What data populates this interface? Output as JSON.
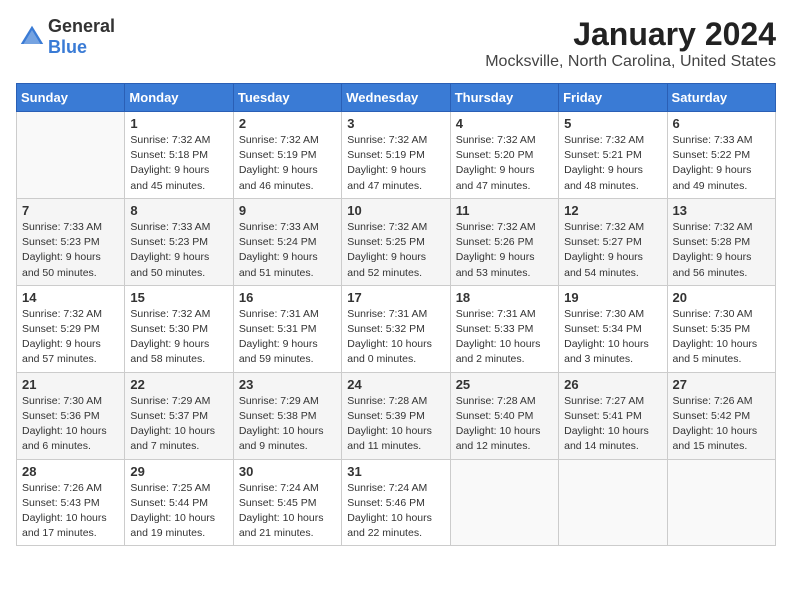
{
  "header": {
    "logo_general": "General",
    "logo_blue": "Blue",
    "month": "January 2024",
    "location": "Mocksville, North Carolina, United States"
  },
  "days_of_week": [
    "Sunday",
    "Monday",
    "Tuesday",
    "Wednesday",
    "Thursday",
    "Friday",
    "Saturday"
  ],
  "weeks": [
    [
      {
        "day": "",
        "content": ""
      },
      {
        "day": "1",
        "content": "Sunrise: 7:32 AM\nSunset: 5:18 PM\nDaylight: 9 hours\nand 45 minutes."
      },
      {
        "day": "2",
        "content": "Sunrise: 7:32 AM\nSunset: 5:19 PM\nDaylight: 9 hours\nand 46 minutes."
      },
      {
        "day": "3",
        "content": "Sunrise: 7:32 AM\nSunset: 5:19 PM\nDaylight: 9 hours\nand 47 minutes."
      },
      {
        "day": "4",
        "content": "Sunrise: 7:32 AM\nSunset: 5:20 PM\nDaylight: 9 hours\nand 47 minutes."
      },
      {
        "day": "5",
        "content": "Sunrise: 7:32 AM\nSunset: 5:21 PM\nDaylight: 9 hours\nand 48 minutes."
      },
      {
        "day": "6",
        "content": "Sunrise: 7:33 AM\nSunset: 5:22 PM\nDaylight: 9 hours\nand 49 minutes."
      }
    ],
    [
      {
        "day": "7",
        "content": "Sunrise: 7:33 AM\nSunset: 5:23 PM\nDaylight: 9 hours\nand 50 minutes."
      },
      {
        "day": "8",
        "content": "Sunrise: 7:33 AM\nSunset: 5:23 PM\nDaylight: 9 hours\nand 50 minutes."
      },
      {
        "day": "9",
        "content": "Sunrise: 7:33 AM\nSunset: 5:24 PM\nDaylight: 9 hours\nand 51 minutes."
      },
      {
        "day": "10",
        "content": "Sunrise: 7:32 AM\nSunset: 5:25 PM\nDaylight: 9 hours\nand 52 minutes."
      },
      {
        "day": "11",
        "content": "Sunrise: 7:32 AM\nSunset: 5:26 PM\nDaylight: 9 hours\nand 53 minutes."
      },
      {
        "day": "12",
        "content": "Sunrise: 7:32 AM\nSunset: 5:27 PM\nDaylight: 9 hours\nand 54 minutes."
      },
      {
        "day": "13",
        "content": "Sunrise: 7:32 AM\nSunset: 5:28 PM\nDaylight: 9 hours\nand 56 minutes."
      }
    ],
    [
      {
        "day": "14",
        "content": "Sunrise: 7:32 AM\nSunset: 5:29 PM\nDaylight: 9 hours\nand 57 minutes."
      },
      {
        "day": "15",
        "content": "Sunrise: 7:32 AM\nSunset: 5:30 PM\nDaylight: 9 hours\nand 58 minutes."
      },
      {
        "day": "16",
        "content": "Sunrise: 7:31 AM\nSunset: 5:31 PM\nDaylight: 9 hours\nand 59 minutes."
      },
      {
        "day": "17",
        "content": "Sunrise: 7:31 AM\nSunset: 5:32 PM\nDaylight: 10 hours\nand 0 minutes."
      },
      {
        "day": "18",
        "content": "Sunrise: 7:31 AM\nSunset: 5:33 PM\nDaylight: 10 hours\nand 2 minutes."
      },
      {
        "day": "19",
        "content": "Sunrise: 7:30 AM\nSunset: 5:34 PM\nDaylight: 10 hours\nand 3 minutes."
      },
      {
        "day": "20",
        "content": "Sunrise: 7:30 AM\nSunset: 5:35 PM\nDaylight: 10 hours\nand 5 minutes."
      }
    ],
    [
      {
        "day": "21",
        "content": "Sunrise: 7:30 AM\nSunset: 5:36 PM\nDaylight: 10 hours\nand 6 minutes."
      },
      {
        "day": "22",
        "content": "Sunrise: 7:29 AM\nSunset: 5:37 PM\nDaylight: 10 hours\nand 7 minutes."
      },
      {
        "day": "23",
        "content": "Sunrise: 7:29 AM\nSunset: 5:38 PM\nDaylight: 10 hours\nand 9 minutes."
      },
      {
        "day": "24",
        "content": "Sunrise: 7:28 AM\nSunset: 5:39 PM\nDaylight: 10 hours\nand 11 minutes."
      },
      {
        "day": "25",
        "content": "Sunrise: 7:28 AM\nSunset: 5:40 PM\nDaylight: 10 hours\nand 12 minutes."
      },
      {
        "day": "26",
        "content": "Sunrise: 7:27 AM\nSunset: 5:41 PM\nDaylight: 10 hours\nand 14 minutes."
      },
      {
        "day": "27",
        "content": "Sunrise: 7:26 AM\nSunset: 5:42 PM\nDaylight: 10 hours\nand 15 minutes."
      }
    ],
    [
      {
        "day": "28",
        "content": "Sunrise: 7:26 AM\nSunset: 5:43 PM\nDaylight: 10 hours\nand 17 minutes."
      },
      {
        "day": "29",
        "content": "Sunrise: 7:25 AM\nSunset: 5:44 PM\nDaylight: 10 hours\nand 19 minutes."
      },
      {
        "day": "30",
        "content": "Sunrise: 7:24 AM\nSunset: 5:45 PM\nDaylight: 10 hours\nand 21 minutes."
      },
      {
        "day": "31",
        "content": "Sunrise: 7:24 AM\nSunset: 5:46 PM\nDaylight: 10 hours\nand 22 minutes."
      },
      {
        "day": "",
        "content": ""
      },
      {
        "day": "",
        "content": ""
      },
      {
        "day": "",
        "content": ""
      }
    ]
  ]
}
